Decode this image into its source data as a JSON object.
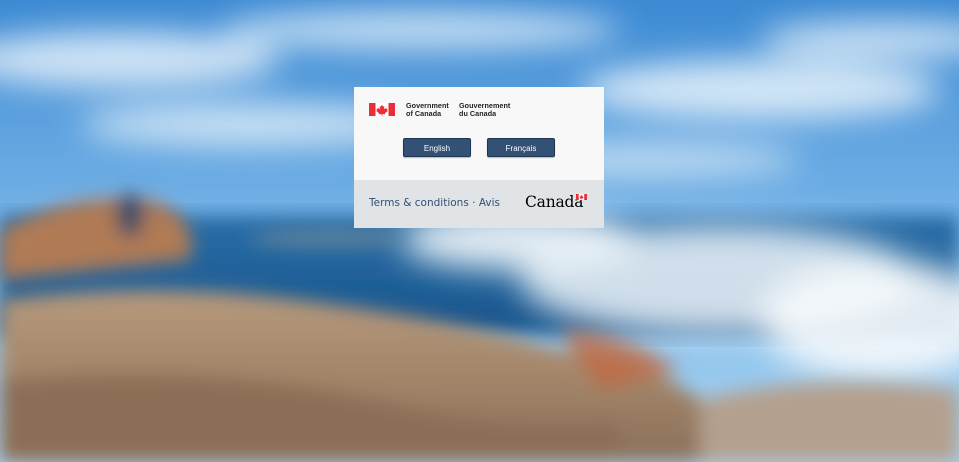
{
  "signature": {
    "en_line1": "Government",
    "en_line2": "of Canada",
    "fr_line1": "Gouvernement",
    "fr_line2": "du Canada"
  },
  "language_buttons": {
    "english_label": "English",
    "french_label": "Français"
  },
  "footer": {
    "terms_label": "Terms & conditions",
    "separator": " · ",
    "avis_label": "Avis",
    "wordmark_text": "Canada"
  },
  "colors": {
    "button_bg": "#335075",
    "footer_bg": "#e1e4e7",
    "card_bg": "#f8f8f8",
    "flag_red": "#eb2d37",
    "link": "#335075"
  },
  "icons": {
    "flag": "canada-flag-icon",
    "wordmark_flag": "canada-wordmark-flag-icon"
  }
}
